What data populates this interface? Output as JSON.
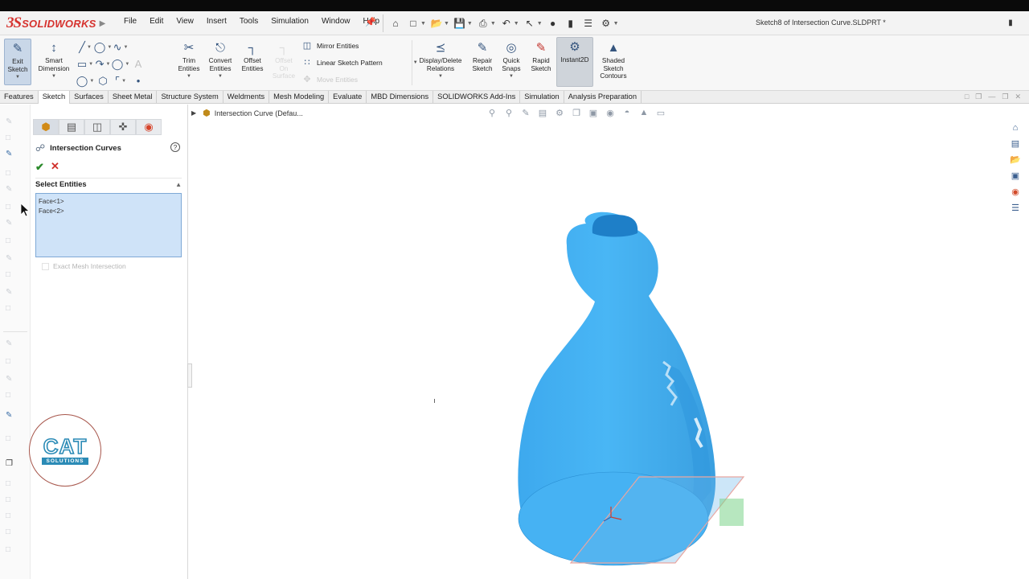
{
  "app": {
    "logo_ds": "3S",
    "logo_text": "SOLIDWORKS",
    "menu": [
      "File",
      "Edit",
      "View",
      "Insert",
      "Tools",
      "Simulation",
      "Window",
      "Help"
    ],
    "document_title": "Sketch8 of Intersection Curve.SLDPRT *"
  },
  "ribbon": {
    "exit_sketch": "Exit\nSketch",
    "smart_dimension": "Smart\nDimension",
    "trim_entities": "Trim\nEntities",
    "convert_entities": "Convert\nEntities",
    "offset_entities": "Offset\nEntities",
    "offset_on_surface": "Offset\nOn\nSurface",
    "mirror_entities": "Mirror Entities",
    "linear_sketch_pattern": "Linear Sketch Pattern",
    "move_entities": "Move Entities",
    "display_delete_relations": "Display/Delete\nRelations",
    "repair_sketch": "Repair\nSketch",
    "quick_snaps": "Quick\nSnaps",
    "rapid_sketch": "Rapid\nSketch",
    "instant2d": "Instant2D",
    "shaded_sketch_contours": "Shaded\nSketch\nContours"
  },
  "tabs": [
    "Features",
    "Sketch",
    "Surfaces",
    "Sheet Metal",
    "Structure System",
    "Weldments",
    "Mesh Modeling",
    "Evaluate",
    "MBD Dimensions",
    "SOLIDWORKS Add-Ins",
    "Simulation",
    "Analysis Preparation"
  ],
  "active_tab": "Sketch",
  "breadcrumb": "Intersection Curve  (Defau...",
  "property_manager": {
    "title": "Intersection Curves",
    "help": "?",
    "section_title": "Select Entities",
    "selections": [
      "Face<1>",
      "Face<2>"
    ],
    "option_label": "Exact Mesh Intersection"
  },
  "watermark": {
    "big": "CAT",
    "small": "SOLUTIONS"
  },
  "colors": {
    "accent": "#35557e",
    "model": "#45b1f2",
    "model_dark": "#1e7fc8",
    "plane": "#e9a6a0",
    "selection": "#cfe3f8",
    "logo_red": "#d6322e"
  }
}
